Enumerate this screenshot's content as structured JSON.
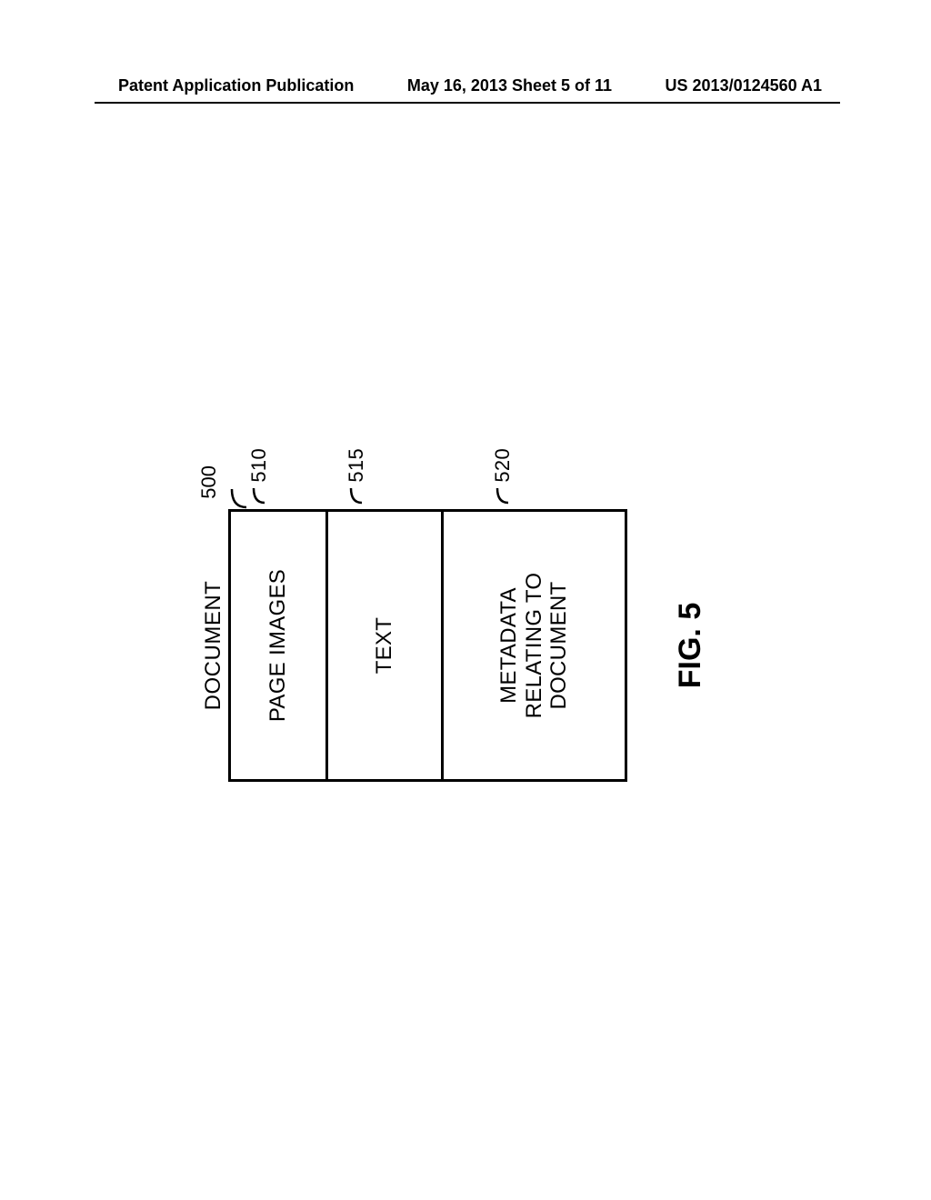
{
  "header": {
    "left": "Patent Application Publication",
    "center": "May 16, 2013  Sheet 5 of 11",
    "right": "US 2013/0124560 A1"
  },
  "diagram": {
    "title": "DOCUMENT",
    "ref_main": "500",
    "boxes": [
      {
        "label": "PAGE IMAGES",
        "ref": "510"
      },
      {
        "label": "TEXT",
        "ref": "515"
      },
      {
        "label": "METADATA\nRELATING TO\nDOCUMENT",
        "ref": "520"
      }
    ],
    "caption": "FIG. 5"
  }
}
